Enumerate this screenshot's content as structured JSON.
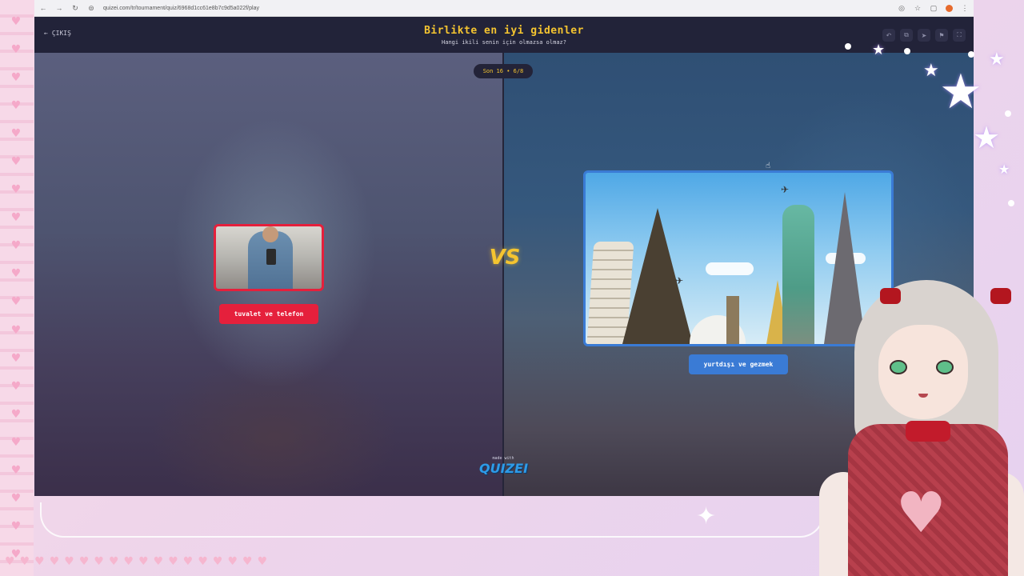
{
  "browser": {
    "url": "quizei.com/tr/tournament/quiz/6968d1cc61e8b7c9d5a022f/play"
  },
  "header": {
    "exit_label": "ÇIKIŞ",
    "title": "Birlikte en iyi gidenler",
    "subtitle": "Hangi ikili senin için olmazsa olmaz?",
    "tools": [
      "undo-icon",
      "copy-icon",
      "share-icon",
      "flag-icon",
      "fullscreen-icon"
    ]
  },
  "round": {
    "badge": "Son 16 • 6/8"
  },
  "versus": {
    "label": "VS"
  },
  "choices": {
    "left": {
      "label": "tuvalet ve telefon",
      "accent": "#e5203c"
    },
    "right": {
      "label": "yurtdışı ve gezmek",
      "accent": "#3a7bd5"
    }
  },
  "footer": {
    "made_with": "made with",
    "brand": "QUIZEI"
  },
  "colors": {
    "title": "#f4c430",
    "header_bg": "#222339"
  }
}
